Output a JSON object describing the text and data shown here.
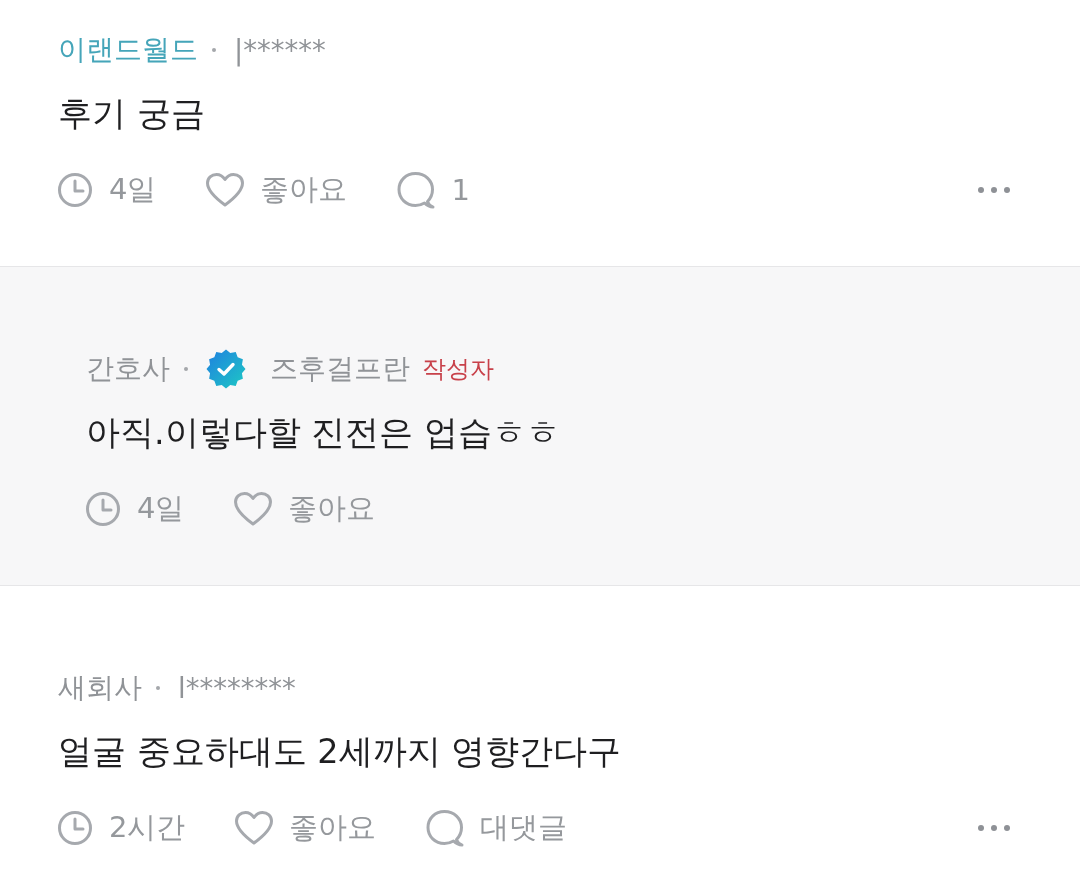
{
  "comments": [
    {
      "kind": "comment",
      "company": {
        "name": "이랜드월드",
        "color": "#45a5b9"
      },
      "author": "|******",
      "verified": false,
      "text": "후기 궁금",
      "time": "4일",
      "like_label": "좋아요",
      "liked": false,
      "reply_label": "1",
      "has_menu": true
    },
    {
      "kind": "reply",
      "company": {
        "name": "간호사",
        "color": "#909397"
      },
      "author": "즈후걸프란",
      "author_tag": "작성자",
      "verified": true,
      "text": "아직.이렇다할 진전은 업습ㅎㅎ",
      "time": "4일",
      "like_label": "좋아요",
      "liked": false,
      "has_menu": false
    },
    {
      "kind": "comment",
      "company": {
        "name": "새회사",
        "color": "#909397"
      },
      "author": "l********",
      "verified": false,
      "text": "얼굴 중요하대도 2세까지 영향간다구",
      "time": "2시간",
      "like_label": "좋아요",
      "liked": false,
      "reply_label": "대댓글",
      "has_menu": true
    }
  ]
}
